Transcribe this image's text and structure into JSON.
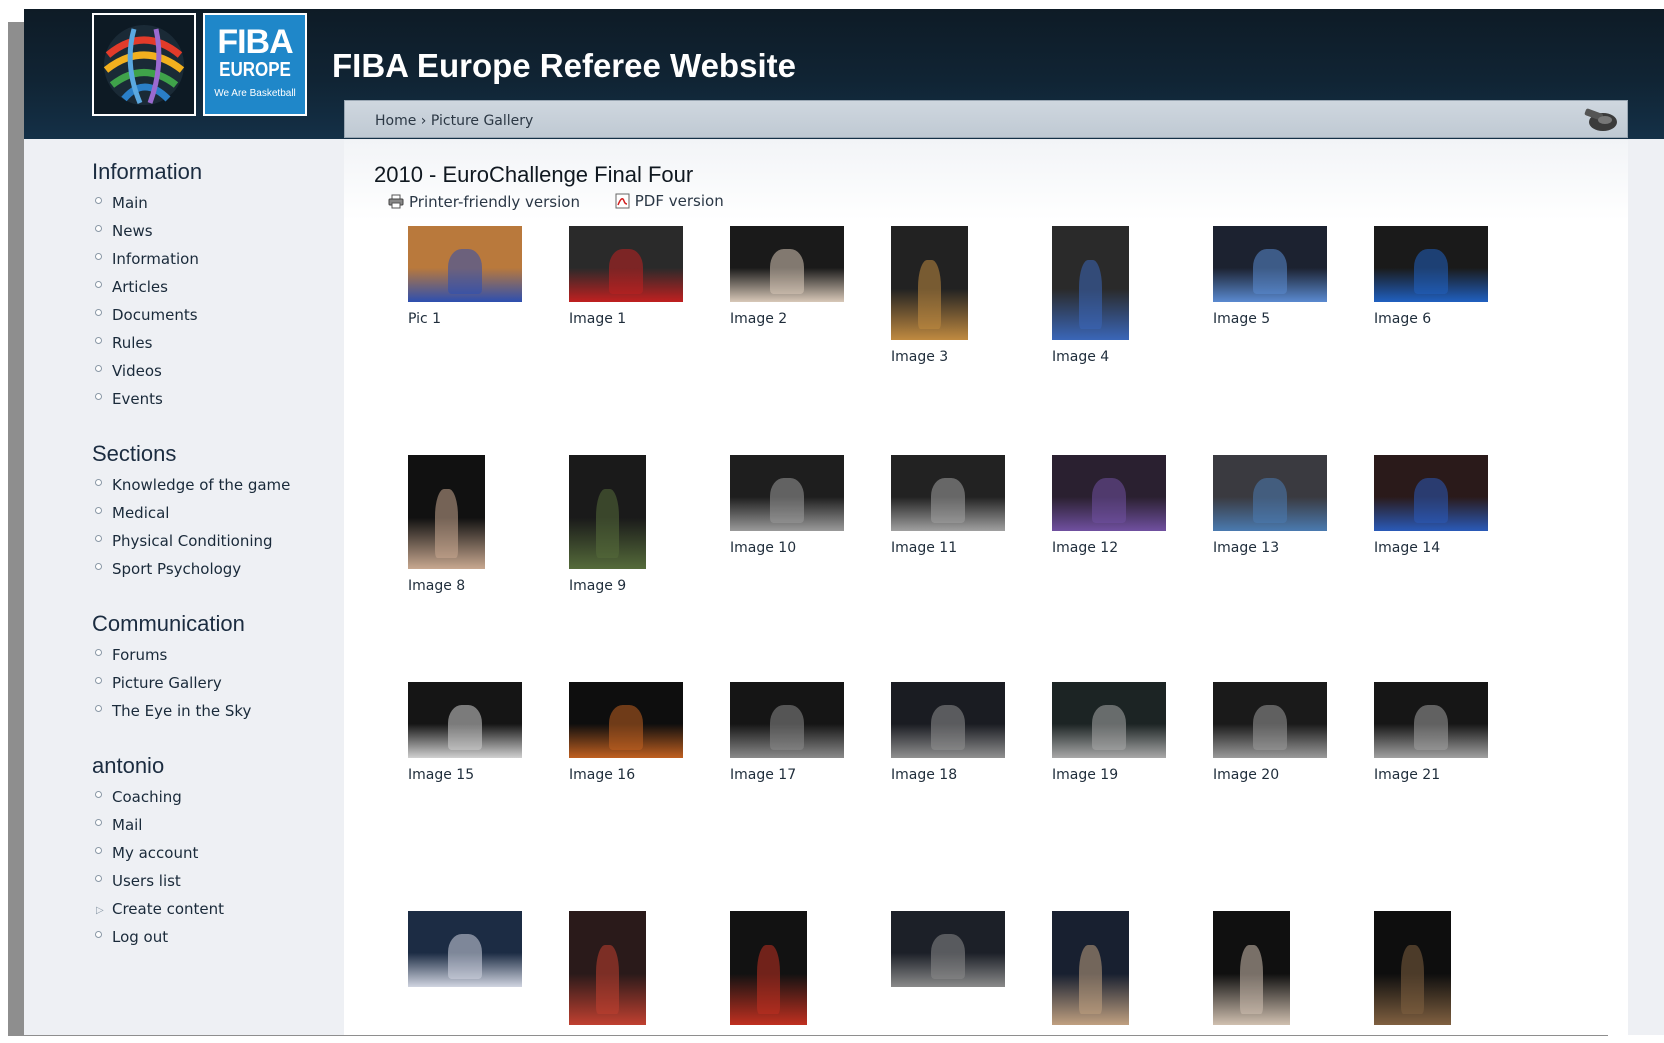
{
  "header": {
    "site_title": "FIBA Europe Referee Website",
    "logo": {
      "line1": "FIBA",
      "line2": "EUROPE",
      "line3": "We Are Basketball"
    }
  },
  "breadcrumb": {
    "home": "Home",
    "separator": "›",
    "current": "Picture Gallery"
  },
  "sidebar": [
    {
      "title": "Information",
      "items": [
        "Main",
        "News",
        "Information",
        "Articles",
        "Documents",
        "Rules",
        "Videos",
        "Events"
      ]
    },
    {
      "title": "Sections",
      "items": [
        "Knowledge of the game",
        "Medical",
        "Physical Conditioning",
        "Sport Psychology"
      ]
    },
    {
      "title": "Communication",
      "items": [
        "Forums",
        "Picture Gallery",
        "The Eye in the Sky"
      ]
    },
    {
      "title": "antonio",
      "items": [
        "Coaching",
        "Mail",
        "My account",
        "Users list",
        "Create content",
        "Log out"
      ]
    }
  ],
  "content": {
    "title": "2010 - EuroChallenge Final Four",
    "printer_link": "Printer-friendly version",
    "pdf_link": "PDF version"
  },
  "gallery": [
    {
      "caption": "Pic 1",
      "orient": "land",
      "colors": [
        "#b9793c",
        "#2d4fb0"
      ]
    },
    {
      "caption": "Image 1",
      "orient": "land",
      "colors": [
        "#2a2a2a",
        "#c02020"
      ]
    },
    {
      "caption": "Image 2",
      "orient": "land",
      "colors": [
        "#1a1a1a",
        "#d8c8b8"
      ]
    },
    {
      "caption": "Image 3",
      "orient": "port",
      "colors": [
        "#222222",
        "#c08a40"
      ]
    },
    {
      "caption": "Image 4",
      "orient": "port",
      "colors": [
        "#2a2a2a",
        "#3a66b8"
      ]
    },
    {
      "caption": "Image 5",
      "orient": "land",
      "colors": [
        "#1c2230",
        "#5a8ad0"
      ]
    },
    {
      "caption": "Image 6",
      "orient": "land",
      "colors": [
        "#1a1a1a",
        "#2060c0"
      ]
    },
    {
      "caption": "Image 8",
      "orient": "port",
      "colors": [
        "#111111",
        "#c8a890"
      ]
    },
    {
      "caption": "Image 9",
      "orient": "port",
      "colors": [
        "#1a1a1a",
        "#556b3a"
      ]
    },
    {
      "caption": "Image 10",
      "orient": "land",
      "colors": [
        "#1e1e1e",
        "#9a9a9a"
      ]
    },
    {
      "caption": "Image 11",
      "orient": "land",
      "colors": [
        "#222222",
        "#a0a0a0"
      ]
    },
    {
      "caption": "Image 12",
      "orient": "land",
      "colors": [
        "#2a2030",
        "#7050a0"
      ]
    },
    {
      "caption": "Image 13",
      "orient": "land",
      "colors": [
        "#3a3a40",
        "#4a7ab0"
      ]
    },
    {
      "caption": "Image 14",
      "orient": "land",
      "colors": [
        "#2a1a1a",
        "#2a5ab8"
      ]
    },
    {
      "caption": "Image 15",
      "orient": "land",
      "colors": [
        "#151515",
        "#d0d0d0"
      ]
    },
    {
      "caption": "Image 16",
      "orient": "land",
      "colors": [
        "#0e0e0e",
        "#c06020"
      ]
    },
    {
      "caption": "Image 17",
      "orient": "land",
      "colors": [
        "#151515",
        "#8a8a8a"
      ]
    },
    {
      "caption": "Image 18",
      "orient": "land",
      "colors": [
        "#1a1c22",
        "#909090"
      ]
    },
    {
      "caption": "Image 19",
      "orient": "land",
      "colors": [
        "#1c2424",
        "#a8a8a8"
      ]
    },
    {
      "caption": "Image 20",
      "orient": "land",
      "colors": [
        "#1a1a1a",
        "#9a9a9a"
      ]
    },
    {
      "caption": "Image 21",
      "orient": "land",
      "colors": [
        "#161616",
        "#a0a0a0"
      ]
    },
    {
      "caption": "",
      "orient": "land",
      "colors": [
        "#1c2c44",
        "#d0d4e0"
      ]
    },
    {
      "caption": "",
      "orient": "port",
      "colors": [
        "#2a1a1a",
        "#c04030"
      ]
    },
    {
      "caption": "",
      "orient": "port",
      "colors": [
        "#121212",
        "#c03020"
      ]
    },
    {
      "caption": "",
      "orient": "land",
      "colors": [
        "#1c2028",
        "#8a8a8a"
      ]
    },
    {
      "caption": "",
      "orient": "port",
      "colors": [
        "#182030",
        "#c0a080"
      ]
    },
    {
      "caption": "",
      "orient": "port",
      "colors": [
        "#101010",
        "#d0c0b0"
      ]
    },
    {
      "caption": "",
      "orient": "port",
      "colors": [
        "#0e0e0e",
        "#806040"
      ]
    }
  ]
}
